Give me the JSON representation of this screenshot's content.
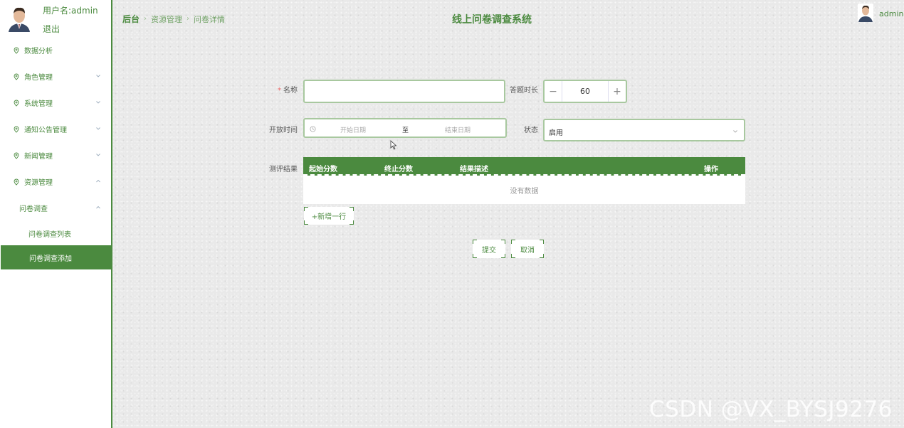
{
  "user": {
    "name_label": "用户名:admin",
    "logout_label": "退出"
  },
  "sidebar": {
    "items": [
      {
        "label": "数据分析",
        "chevron": ""
      },
      {
        "label": "角色管理",
        "chevron": "down"
      },
      {
        "label": "系统管理",
        "chevron": "down"
      },
      {
        "label": "通知公告管理",
        "chevron": "down"
      },
      {
        "label": "新闻管理",
        "chevron": "down"
      },
      {
        "label": "资源管理",
        "chevron": "up"
      }
    ],
    "submenu": {
      "label": "问卷调查",
      "chevron": "up"
    },
    "leaves": [
      {
        "label": "问卷调查列表",
        "active": false
      },
      {
        "label": "问卷调查添加",
        "active": true
      }
    ]
  },
  "header": {
    "breadcrumb": [
      "后台",
      "资源管理",
      "问卷详情"
    ],
    "title": "线上问卷调查系统",
    "username": "admin"
  },
  "form": {
    "name_label": "名称",
    "name_required_mark": "*",
    "name_value": "",
    "duration_label": "答题时长",
    "duration_value": "60",
    "duration_minus": "−",
    "duration_plus": "+",
    "open_time_label": "开放时间",
    "start_placeholder": "开始日期",
    "range_separator": "至",
    "end_placeholder": "结束日期",
    "status_label": "状态",
    "status_value": "启用",
    "result_label": "测评结果",
    "table_headers": [
      "起始分数",
      "终止分数",
      "结果描述",
      "操作"
    ],
    "table_empty_text": "没有数据",
    "add_row_label": "+新增一行",
    "submit_label": "提交",
    "cancel_label": "取消"
  },
  "watermark": "CSDN @VX_BYSJ9276",
  "colors": {
    "accent": "#4b8a3f",
    "input_border": "#a8c89f"
  }
}
